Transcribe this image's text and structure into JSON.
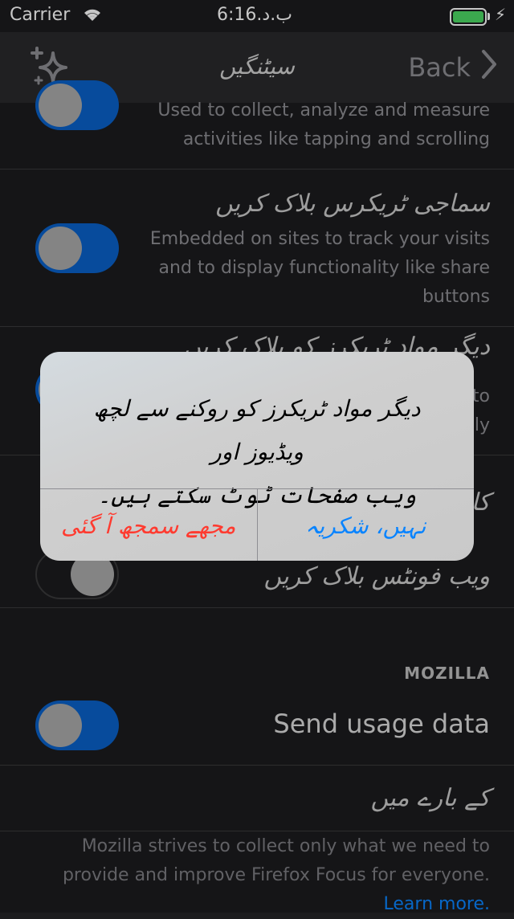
{
  "status_bar": {
    "carrier": "Carrier",
    "period": "ب.د.",
    "time": "6:16"
  },
  "navbar": {
    "title": "سیٹنگیں",
    "back_label": "Back"
  },
  "rows": {
    "analytics_desc_line1": "Used to collect, analyze and measure",
    "analytics_desc_line2": "activities like tapping and scrolling",
    "social_title": "سماجی ٹریکرس بلاک کریں",
    "social_desc_line1": "Embedded on sites to track your visits",
    "social_desc_line2": "and to display functionality like share",
    "social_desc_line3": "buttons",
    "other_title": "دیگر مواد ٹریکرز کو بلاک کریں",
    "other_desc_line1": "to",
    "other_desc_line2": "ly",
    "fonts_partial": "کار",
    "fonts_title": "ویب فونٹس بلاک کریں"
  },
  "mozilla": {
    "header": "MOZILLA",
    "send_usage": "Send usage data",
    "about": "کے بارے میں",
    "footer_line1": "Mozilla strives to collect only what we need to",
    "footer_line2": "provide and improve Firefox Focus for everyone.",
    "learn_more": "Learn more."
  },
  "alert": {
    "message_line1": "دیگر مواد ٹریکرز کو روکنے سے لچھ ویڈیوز اور",
    "message_line2": "ویب صفحات ٹوٹ سکتے ہیں۔",
    "confirm_label": "مجھے سمجھ آ گئی",
    "cancel_label": "نہیں، شکریہ"
  },
  "colors": {
    "accent": "#0a84ff",
    "destructive": "#ff3b30",
    "toggle_on": "#0a60c8"
  },
  "toggles": {
    "analytics": true,
    "social": true,
    "other": true,
    "web_fonts": false,
    "send_usage": true
  }
}
